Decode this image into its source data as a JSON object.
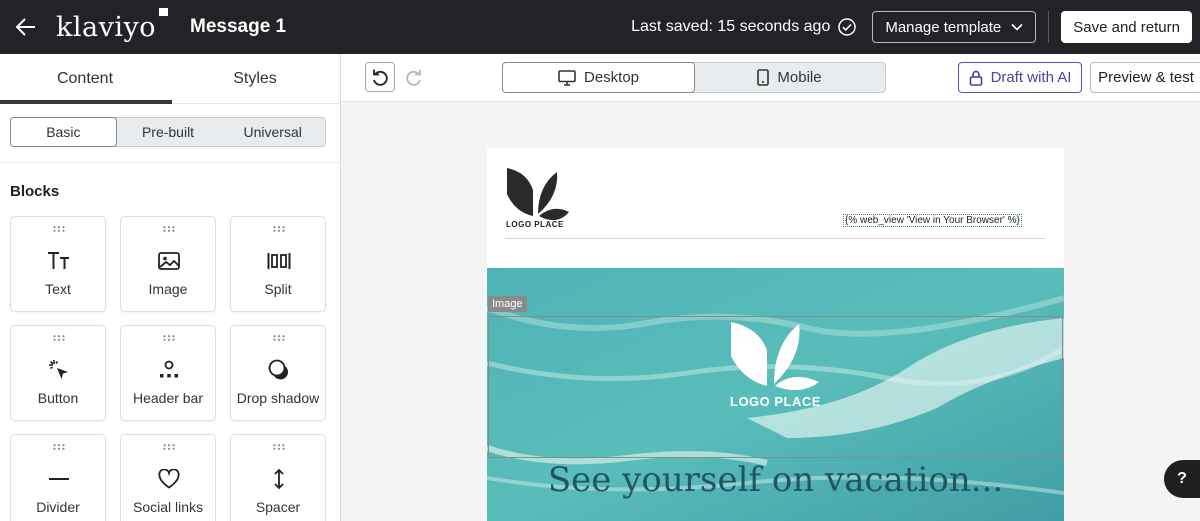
{
  "topbar": {
    "brand": "klaviyo",
    "message_title": "Message 1",
    "last_saved": "Last saved: 15 seconds ago",
    "manage_template": "Manage template",
    "save_and_return": "Save and return"
  },
  "left_panel": {
    "tabs": [
      {
        "label": "Content",
        "active": true
      },
      {
        "label": "Styles",
        "active": false
      }
    ],
    "segments": [
      {
        "label": "Basic",
        "active": true
      },
      {
        "label": "Pre-built",
        "active": false
      },
      {
        "label": "Universal",
        "active": false
      }
    ],
    "blocks_heading": "Blocks",
    "blocks": [
      {
        "label": "Text",
        "icon": "text-icon"
      },
      {
        "label": "Image",
        "icon": "image-icon"
      },
      {
        "label": "Split",
        "icon": "split-icon"
      },
      {
        "label": "Button",
        "icon": "cursor-click-icon"
      },
      {
        "label": "Header bar",
        "icon": "header-bar-icon"
      },
      {
        "label": "Drop shadow",
        "icon": "drop-shadow-icon"
      },
      {
        "label": "Divider",
        "icon": "divider-icon"
      },
      {
        "label": "Social links",
        "icon": "heart-icon"
      },
      {
        "label": "Spacer",
        "icon": "spacer-icon"
      }
    ]
  },
  "toolbar": {
    "devices": [
      {
        "label": "Desktop",
        "icon": "monitor-icon",
        "active": true
      },
      {
        "label": "Mobile",
        "icon": "mobile-icon",
        "active": false
      }
    ],
    "draft_with_ai": "Draft with AI",
    "preview_test": "Preview & test"
  },
  "email": {
    "logo_text": "LOGO PLACE",
    "web_view": "{% web_view 'View in Your Browser' %}",
    "image_tag": "Image",
    "hero_logo_text": "LOGO PLACE",
    "headline": "See yourself on vacation..."
  },
  "help": {
    "label": "?"
  },
  "colors": {
    "topbar": "#222326",
    "accent": "#4b3fa8",
    "headline": "#23545f"
  }
}
